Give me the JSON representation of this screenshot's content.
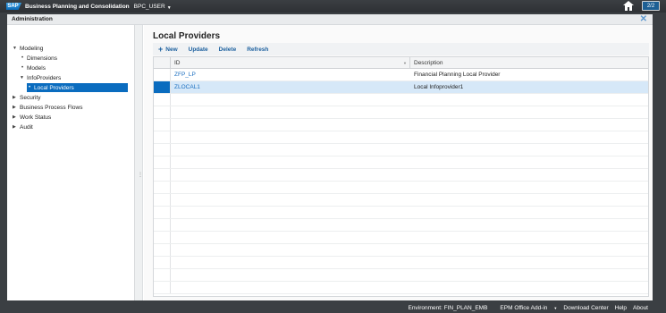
{
  "topbar": {
    "logo": "SAP",
    "app_title": "Business Planning and Consolidation",
    "user": "BPC_USER",
    "screen_badge": "2/2",
    "icons": {
      "home": "home-icon",
      "user_caret": "caret-down-icon"
    }
  },
  "window": {
    "title": "Administration",
    "close_icon": "close-icon"
  },
  "sidebar": {
    "items": [
      {
        "label": "Modeling",
        "toggle": "▼"
      },
      {
        "label": "Dimensions",
        "bullet": "•"
      },
      {
        "label": "Models",
        "bullet": "•"
      },
      {
        "label": "InfoProviders",
        "toggle": "▼"
      },
      {
        "label": "Local Providers",
        "bullet": "•"
      },
      {
        "label": "Security",
        "toggle": "▶"
      },
      {
        "label": "Business Process Flows",
        "toggle": "▶"
      },
      {
        "label": "Work Status",
        "toggle": "▶"
      },
      {
        "label": "Audit",
        "toggle": "▶"
      }
    ],
    "selected": "Local Providers"
  },
  "main": {
    "title": "Local Providers",
    "toolbar": {
      "plus_icon": "+",
      "new_label": "New",
      "update_label": "Update",
      "delete_label": "Delete",
      "refresh_label": "Refresh"
    },
    "grid": {
      "columns": [
        "ID",
        "Description"
      ],
      "rows": [
        {
          "id": "ZFP_LP",
          "description": "Financial Planning Local Provider"
        },
        {
          "id": "ZLOCAL1",
          "description": "Local Infoprovider1"
        }
      ],
      "selected_row": "ZLOCAL1"
    }
  },
  "status_bar": {
    "environment": "Environment: FIN_PLAN_EMB",
    "epm_addin": "EPM Office Add-in",
    "download_center": "Download Center",
    "help": "Help",
    "about": "About"
  },
  "colors": {
    "accent": "#0a6cbf",
    "link": "#1b6fc0",
    "selected_row_bg": "#d6e8f8",
    "shell_bg": "#3b3f43"
  }
}
